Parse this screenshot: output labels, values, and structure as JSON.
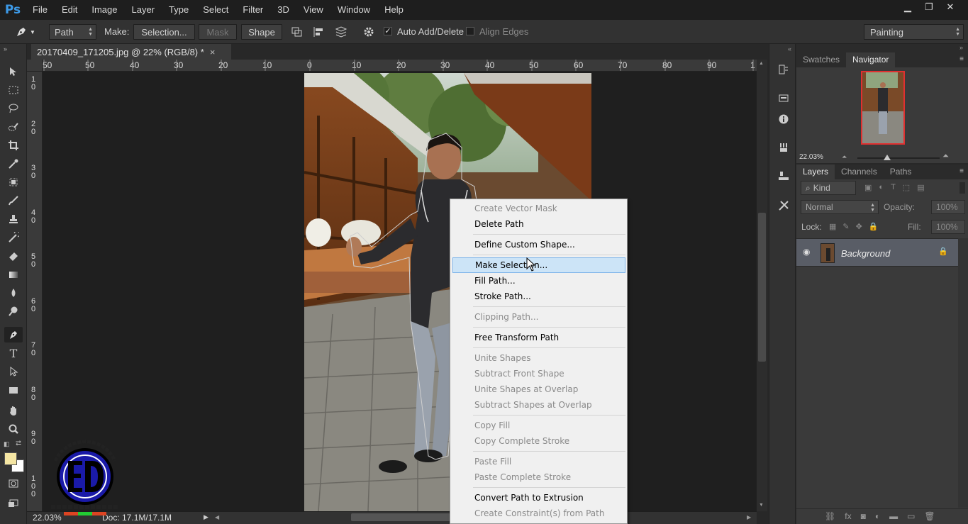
{
  "app": {
    "logo": "Ps"
  },
  "menubar": {
    "items": [
      "File",
      "Edit",
      "Image",
      "Layer",
      "Type",
      "Select",
      "Filter",
      "3D",
      "View",
      "Window",
      "Help"
    ]
  },
  "window_controls": {
    "minimize": "▁",
    "restore": "❐",
    "close": "✕"
  },
  "options": {
    "tool_mode": "Path",
    "make_label": "Make:",
    "selection_btn": "Selection...",
    "mask_btn": "Mask",
    "shape_btn": "Shape",
    "auto_add_delete": "Auto Add/Delete",
    "auto_add_delete_checked": true,
    "align_edges": "Align Edges",
    "align_edges_checked": false,
    "workspace": "Painting"
  },
  "document": {
    "tab_title": "20170409_171205.jpg @ 22% (RGB/8) *",
    "close": "×"
  },
  "ruler": {
    "h_ticks": [
      "50",
      "50",
      "40",
      "30",
      "20",
      "10",
      "0",
      "10",
      "20",
      "30",
      "40",
      "50",
      "60",
      "70",
      "80",
      "90",
      "1"
    ],
    "v_ticks": [
      "10",
      "20",
      "30",
      "40",
      "50",
      "60",
      "70",
      "80",
      "90",
      "100"
    ]
  },
  "status": {
    "zoom": "22.03%",
    "doc": "Doc: 17.1M/17.1M"
  },
  "navigator": {
    "tabs": [
      "Swatches",
      "Navigator"
    ],
    "active": "Navigator",
    "zoom": "22.03%"
  },
  "layers": {
    "tabs": [
      "Layers",
      "Channels",
      "Paths"
    ],
    "active": "Layers",
    "kind_filter": "Kind",
    "blend_mode": "Normal",
    "opacity_label": "Opacity:",
    "opacity": "100%",
    "lock_label": "Lock:",
    "fill_label": "Fill:",
    "fill": "100%",
    "items": [
      {
        "name": "Background",
        "visible": true,
        "locked": true
      }
    ]
  },
  "context_menu": {
    "items": [
      {
        "label": "Create Vector Mask",
        "enabled": false
      },
      {
        "label": "Delete Path",
        "enabled": true
      },
      {
        "label": "Define Custom Shape...",
        "enabled": true
      },
      {
        "label": "Make Selection...",
        "enabled": true,
        "highlighted": true
      },
      {
        "label": "Fill Path...",
        "enabled": true
      },
      {
        "label": "Stroke Path...",
        "enabled": true
      },
      {
        "label": "Clipping Path...",
        "enabled": false
      },
      {
        "label": "Free Transform Path",
        "enabled": true
      },
      {
        "label": "Unite Shapes",
        "enabled": false
      },
      {
        "label": "Subtract Front Shape",
        "enabled": false
      },
      {
        "label": "Unite Shapes at Overlap",
        "enabled": false
      },
      {
        "label": "Subtract Shapes at Overlap",
        "enabled": false
      },
      {
        "label": "Copy Fill",
        "enabled": false
      },
      {
        "label": "Copy Complete Stroke",
        "enabled": false
      },
      {
        "label": "Paste Fill",
        "enabled": false
      },
      {
        "label": "Paste Complete Stroke",
        "enabled": false
      },
      {
        "label": "Convert Path to Extrusion",
        "enabled": true
      },
      {
        "label": "Create Constraint(s) from Path",
        "enabled": false
      }
    ]
  },
  "colors": {
    "foreground": "#f5e6a3",
    "background": "#ffffff",
    "menu_highlight": "#cce4f7",
    "ps_blue": "#3d9ae8"
  }
}
